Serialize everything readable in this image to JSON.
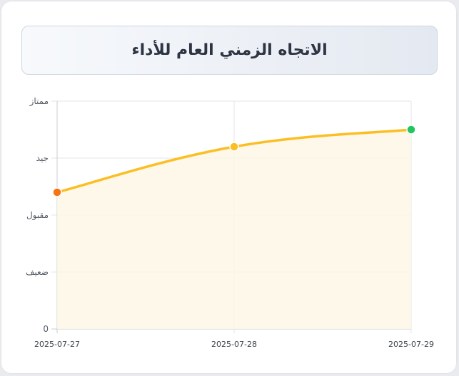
{
  "chart_data": {
    "type": "line",
    "title": "الاتجاه الزمني العام للأداء",
    "x": [
      "2025-07-27",
      "2025-07-28",
      "2025-07-29"
    ],
    "y_tick_labels": [
      "0",
      "ضعيف",
      "مقبول",
      "جيد",
      "ممتاز"
    ],
    "ylim": [
      0,
      4
    ],
    "series": [
      {
        "values": [
          2.4,
          3.2,
          3.5
        ],
        "line_color": "#fbbf24",
        "fill_color": "#fef7e6",
        "point_colors": [
          "#f97316",
          "#fbbf24",
          "#22c55e"
        ]
      }
    ],
    "grid": true,
    "legend": false
  }
}
